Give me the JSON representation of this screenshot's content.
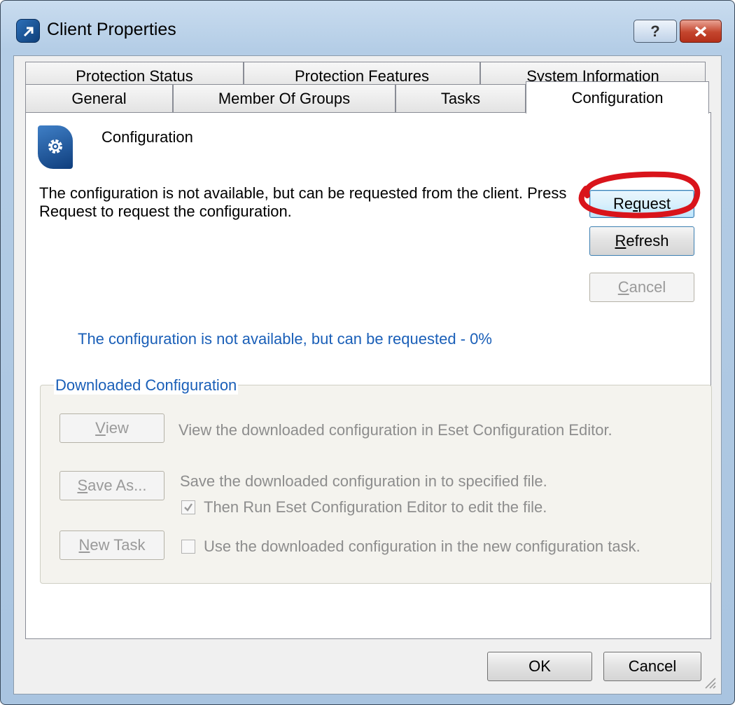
{
  "window": {
    "title": "Client Properties"
  },
  "tabs_row1": [
    "Protection Status",
    "Protection Features",
    "System Information"
  ],
  "tabs_row2": [
    "General",
    "Member Of Groups",
    "Tasks",
    "Configuration"
  ],
  "panel": {
    "title": "Configuration",
    "message": "The configuration is not available, but can be requested from the client. Press Request to request the configuration.",
    "status": "The configuration is not available, but can be requested - 0%"
  },
  "buttons": {
    "request": {
      "pre": "Re",
      "key": "q",
      "post": "uest"
    },
    "refresh": {
      "key": "R",
      "post": "efresh"
    },
    "cancel_panel": {
      "key": "C",
      "post": "ancel"
    }
  },
  "group": {
    "label": "Downloaded Configuration",
    "view": {
      "key": "V",
      "post": "iew",
      "desc": "View the downloaded configuration in Eset Configuration Editor."
    },
    "save_as": {
      "key": "S",
      "post": "ave As...",
      "desc": "Save the downloaded configuration in to specified file."
    },
    "run_editor": {
      "label": "Then Run Eset Configuration Editor to edit the file.",
      "checked": true
    },
    "new_task": {
      "key": "N",
      "post": "ew Task"
    },
    "use_config": {
      "label": "Use the downloaded configuration in the new configuration task.",
      "checked": false
    }
  },
  "footer": {
    "ok": "OK",
    "cancel": "Cancel"
  },
  "colors": {
    "accent_text": "#1a5fb8",
    "annotation": "#d9141b",
    "close_button": "#c4452d"
  },
  "icons": {
    "app": "eset-remote-arrow-icon",
    "config": "gear-icon"
  }
}
